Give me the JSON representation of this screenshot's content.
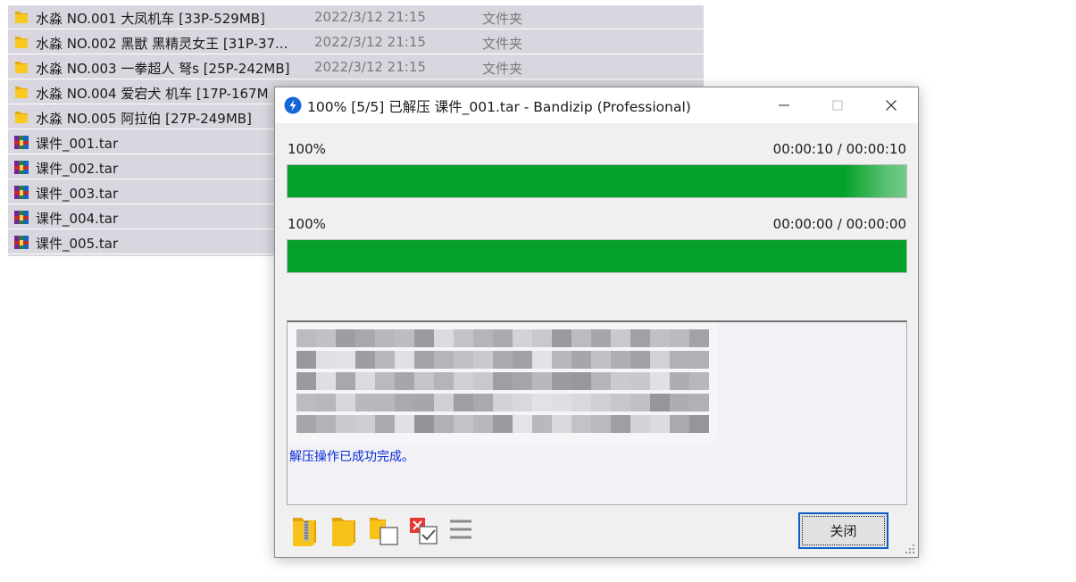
{
  "explorer": {
    "rows": [
      {
        "name": "水淼 NO.001 大凤机车 [33P-529MB]",
        "date": "2022/3/12 21:15",
        "type": "文件夹",
        "icon": "folder-icon"
      },
      {
        "name": "水淼 NO.002 黑獣 黑精灵女王 [31P-37...",
        "date": "2022/3/12 21:15",
        "type": "文件夹",
        "icon": "folder-icon"
      },
      {
        "name": "水淼 NO.003 一拳超人 弩s [25P-242MB]",
        "date": "2022/3/12 21:15",
        "type": "文件夹",
        "icon": "folder-icon"
      },
      {
        "name": "水淼 NO.004 爱宕犬 机车 [17P-167M",
        "date": "",
        "type": "",
        "icon": "folder-icon"
      },
      {
        "name": "水淼 NO.005 阿拉伯 [27P-249MB]",
        "date": "",
        "type": "",
        "icon": "folder-icon"
      },
      {
        "name": "课件_001.tar",
        "date": "",
        "type": "",
        "icon": "archive-icon"
      },
      {
        "name": "课件_002.tar",
        "date": "",
        "type": "",
        "icon": "archive-icon"
      },
      {
        "name": "课件_003.tar",
        "date": "",
        "type": "",
        "icon": "archive-icon"
      },
      {
        "name": "课件_004.tar",
        "date": "",
        "type": "",
        "icon": "archive-icon"
      },
      {
        "name": "课件_005.tar",
        "date": "",
        "type": "",
        "icon": "archive-icon"
      }
    ]
  },
  "dialog": {
    "title": "100% [5/5] 已解压 课件_001.tar - Bandizip (Professional)",
    "progress1": {
      "percent_label": "100%",
      "time": "00:00:10 / 00:00:10",
      "fraction": 1.0
    },
    "progress2": {
      "percent_label": "100%",
      "time": "00:00:00 / 00:00:00",
      "fraction": 1.0
    },
    "log_message": "解压操作已成功完成。",
    "close_label": "关闭",
    "accent_color": "#05a12a",
    "message_color": "#0a2bd6"
  }
}
